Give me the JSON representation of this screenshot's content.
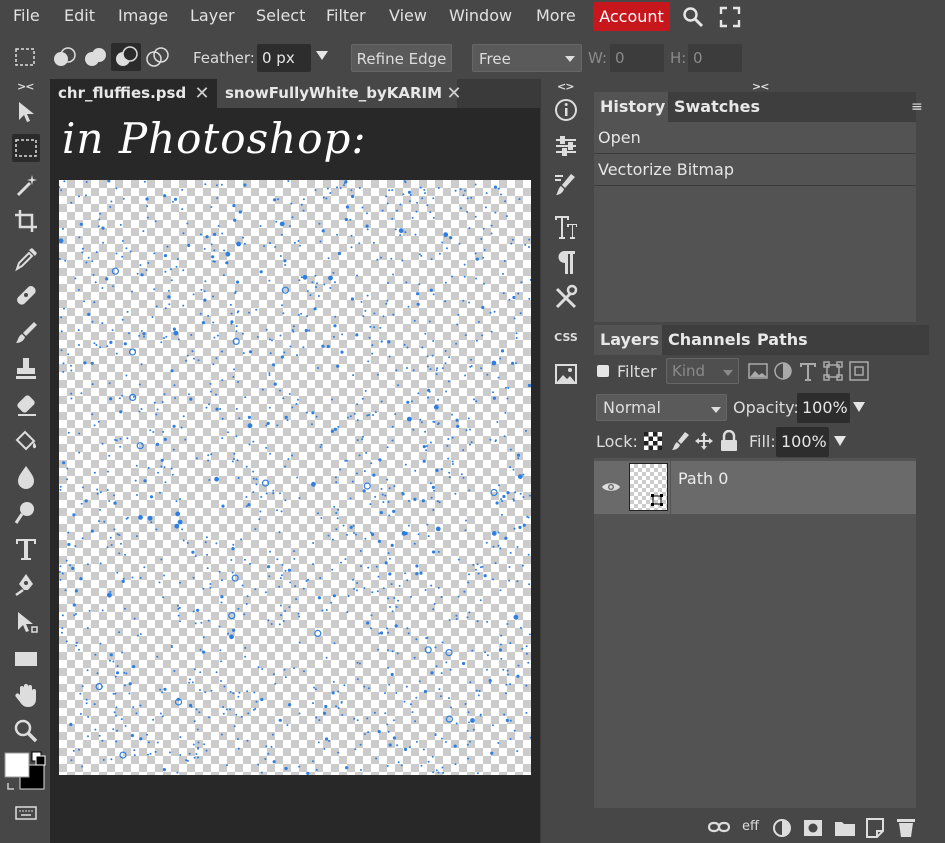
{
  "menu": {
    "items": [
      "File",
      "Edit",
      "Image",
      "Layer",
      "Select",
      "Filter",
      "View",
      "Window",
      "More"
    ],
    "account": "Account"
  },
  "options": {
    "feather_label": "Feather:",
    "feather_value": "0 px",
    "refine_edge": "Refine Edge",
    "style_value": "Free",
    "w_label": "W:",
    "w_value": "0",
    "h_label": "H:",
    "h_value": "0"
  },
  "document": {
    "tabs": [
      {
        "name": "chr_fluffies.psd"
      },
      {
        "name": "snowFullyWhite_byKARIM"
      }
    ],
    "canvas_title": "in Photoshop:"
  },
  "history_panel": {
    "tabs": [
      "History",
      "Swatches"
    ],
    "items": [
      "Open",
      "Vectorize Bitmap"
    ]
  },
  "layers_panel": {
    "tabs": [
      "Layers",
      "Channels",
      "Paths"
    ],
    "filter_label": "Filter",
    "kind_value": "Kind",
    "blend_mode": "Normal",
    "opacity_label": "Opacity:",
    "opacity_value": "100%",
    "lock_label": "Lock:",
    "fill_label": "Fill:",
    "fill_value": "100%",
    "layers": [
      {
        "name": "Path 0"
      }
    ],
    "footer_eff": "eff"
  },
  "mid_strip": {
    "css_label": "CSS"
  },
  "colors": {
    "account_bg": "#c8161d",
    "speck_color": "#2f7fe0"
  }
}
